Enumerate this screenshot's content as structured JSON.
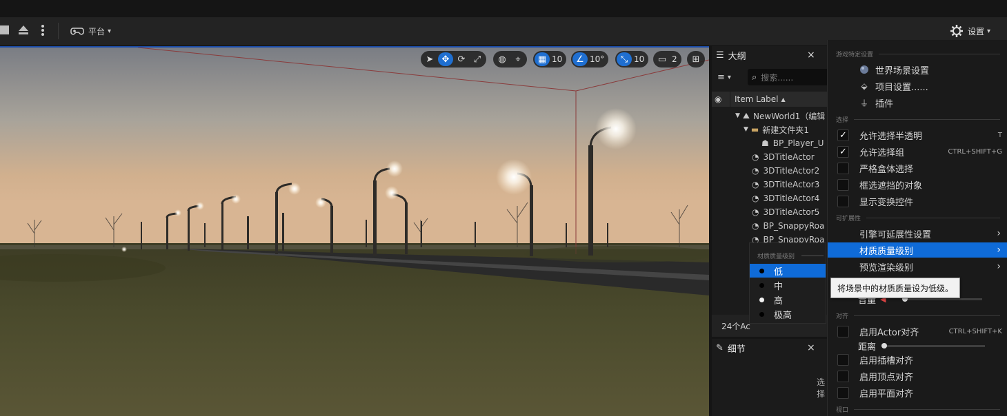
{
  "toolbar": {
    "platform_label": "平台",
    "settings_label": "设置"
  },
  "viewport_toolbar": {
    "grid_snap": "10",
    "rotation_snap": "10°",
    "scale_snap": "10",
    "camera_speed": "2"
  },
  "outliner": {
    "tab_title": "大纲",
    "search_placeholder": "搜索......",
    "column_header": "Item Label",
    "items": [
      {
        "label": "NewWorld1（编辑"
      },
      {
        "label": "新建文件夹1"
      },
      {
        "label": "BP_Player_U"
      },
      {
        "label": "3DTitleActor"
      },
      {
        "label": "3DTitleActor2"
      },
      {
        "label": "3DTitleActor3"
      },
      {
        "label": "3DTitleActor4"
      },
      {
        "label": "3DTitleActor5"
      },
      {
        "label": "BP_SnappyRoa"
      },
      {
        "label": "BP_SnappyRoa"
      }
    ],
    "actor_count": "24个Ac"
  },
  "details": {
    "tab_title": "细节",
    "hint": "选择"
  },
  "quality_menu": {
    "header": "材质质量级别",
    "items": [
      {
        "label": "低",
        "selected": true
      },
      {
        "label": "中",
        "selected": false
      },
      {
        "label": "高",
        "selected": false
      },
      {
        "label": "极高",
        "selected": false
      }
    ]
  },
  "settings_menu": {
    "section_game": "游戏特定设置",
    "world_settings": "世界场景设置",
    "project_settings": "项目设置......",
    "plugins": "插件",
    "section_selection": "选择",
    "allow_translucent": "允许选择半透明",
    "allow_translucent_shortcut": "T",
    "allow_group": "允许选择组",
    "allow_group_shortcut": "CTRL+SHIFT+G",
    "strict_box": "严格盒体选择",
    "occluded": "框选遮挡的对象",
    "show_transform": "显示变换控件",
    "section_scalability": "可扩展性",
    "engine_scalability": "引擎可延展性设置",
    "material_quality": "材质质量级别",
    "preview_rendering": "预览渲染级别",
    "volume_label": "音量",
    "section_snapping": "对齐",
    "actor_snap": "启用Actor对齐",
    "actor_snap_shortcut": "CTRL+SHIFT+K",
    "distance_label": "距离",
    "socket_snap": "启用插槽对齐",
    "vertex_snap": "启用顶点对齐",
    "plane_snap": "启用平面对齐",
    "section_viewport": "视口"
  },
  "tooltip": {
    "text": "将场景中的材质质量设为低级。"
  },
  "colors": {
    "accent": "#0f6bd8",
    "panel": "#1a1a1a",
    "toolbar": "#232323"
  }
}
